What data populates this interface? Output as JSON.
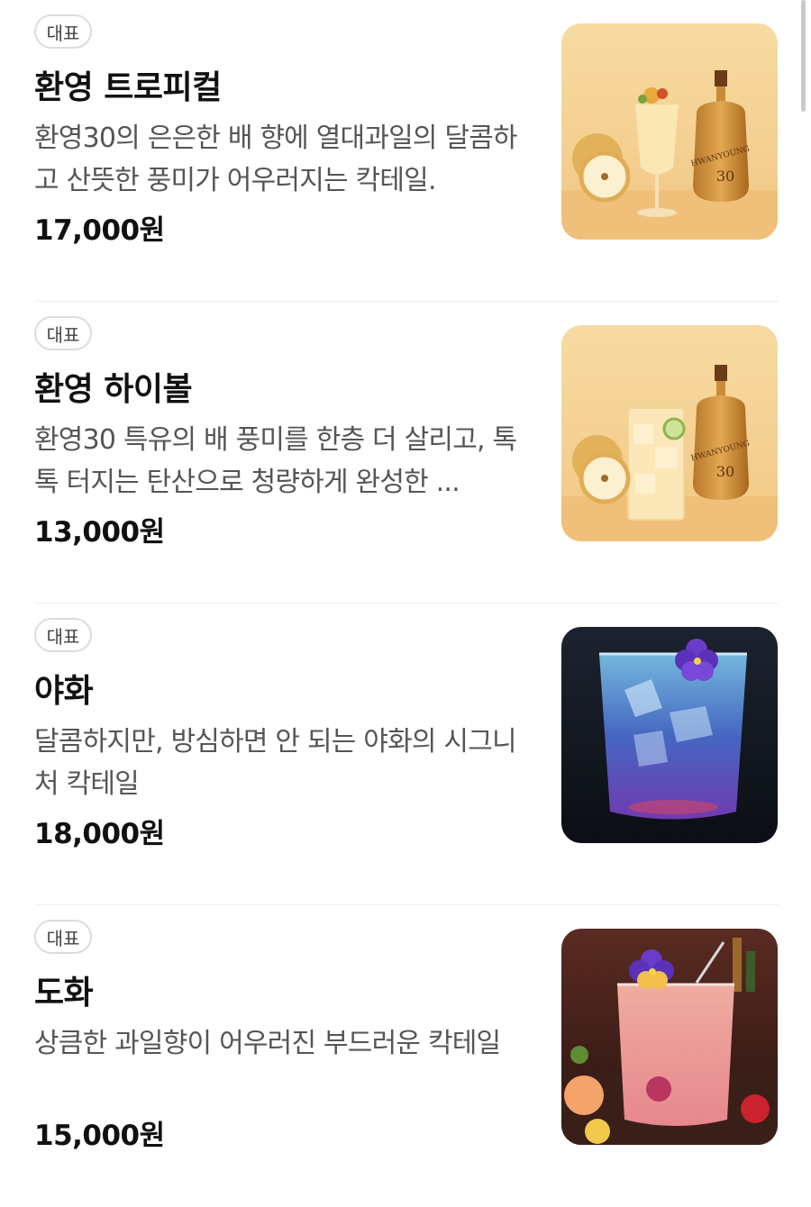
{
  "menu": {
    "items": [
      {
        "badge": "대표",
        "name": "환영 트로피컬",
        "description": "환영30의 은은한 배 향에 열대과일의 달콤하고 산뜻한 풍미가 어우러지는 칵테일.",
        "price": "17,000원",
        "image_icon": "tropical-cocktail-photo"
      },
      {
        "badge": "대표",
        "name": "환영 하이볼",
        "description": "환영30 특유의 배 풍미를 한층 더 살리고, 톡톡 터지는 탄산으로 청량하게 완성한 ...",
        "price": "13,000원",
        "image_icon": "highball-photo"
      },
      {
        "badge": "대표",
        "name": "야화",
        "description": "달콤하지만, 방심하면 안 되는 야화의 시그니처 칵테일",
        "price": "18,000원",
        "image_icon": "blue-cocktail-photo"
      },
      {
        "badge": "대표",
        "name": "도화",
        "description": "상큼한 과일향이 어우러진 부드러운 칵테일",
        "price": "15,000원",
        "image_icon": "pink-cocktail-photo"
      }
    ]
  },
  "bottle_label": {
    "brand": "HWANYOUNG",
    "number": "30"
  },
  "colors": {
    "background": "#ffffff",
    "text_primary": "#111111",
    "text_secondary": "#555555",
    "badge_border": "#dcdcdc",
    "divider": "#eeeeee"
  }
}
